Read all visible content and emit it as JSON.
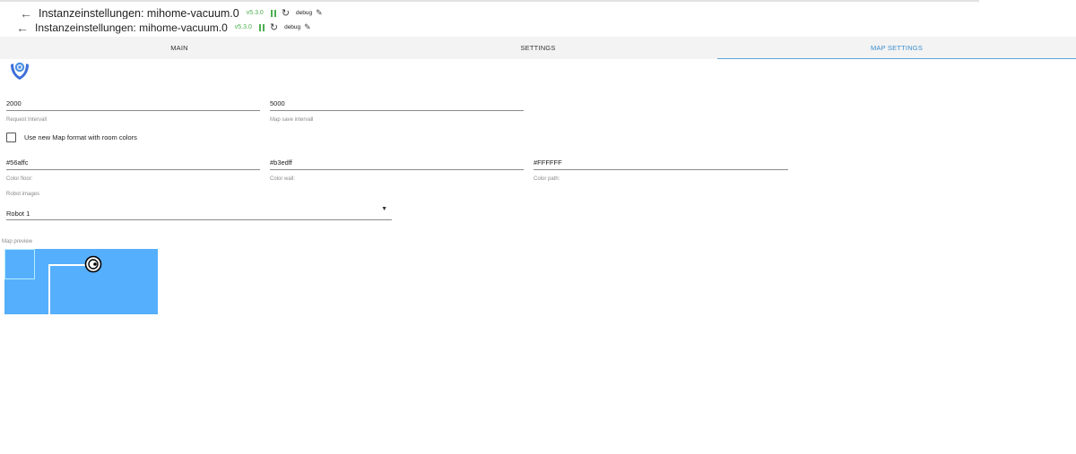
{
  "header": {
    "title": "Instanzeinstellungen: mihome-vacuum.0",
    "version": "v5.3.0",
    "log_level": "debug"
  },
  "tabs": [
    {
      "label": "MAIN",
      "active": false
    },
    {
      "label": "SETTINGS",
      "active": false
    },
    {
      "label": "MAP SETTINGS",
      "active": true
    }
  ],
  "fields": {
    "request_interval": {
      "value": "2000",
      "label": "Request Intervall"
    },
    "map_save_interval": {
      "value": "5000",
      "label": "Map save intervall"
    },
    "color_floor": {
      "value": "#56affc",
      "label": "Color floor:"
    },
    "color_wall": {
      "value": "#b3edff",
      "label": "Color wall:"
    },
    "color_path": {
      "value": "#FFFFFF",
      "label": "Color path:"
    }
  },
  "checkbox": {
    "label": "Use new Map format with room colors",
    "checked": false
  },
  "robot_images": {
    "label": "Robot images",
    "value": "Robot 1"
  },
  "map_preview": {
    "label": "Map preview"
  },
  "icons": {
    "back": "arrow-left-icon",
    "pause": "pause-icon",
    "reload": "reload-icon",
    "edit": "pencil-icon",
    "dropdown": "caret-down-icon",
    "logo": "vacuum-logo-icon",
    "robot": "robot-icon"
  },
  "colors": {
    "accent": "#3b8fcf",
    "status_green": "#4caf50",
    "map_floor": "#56affc",
    "map_wall": "#b3edff",
    "map_path": "#FFFFFF"
  }
}
